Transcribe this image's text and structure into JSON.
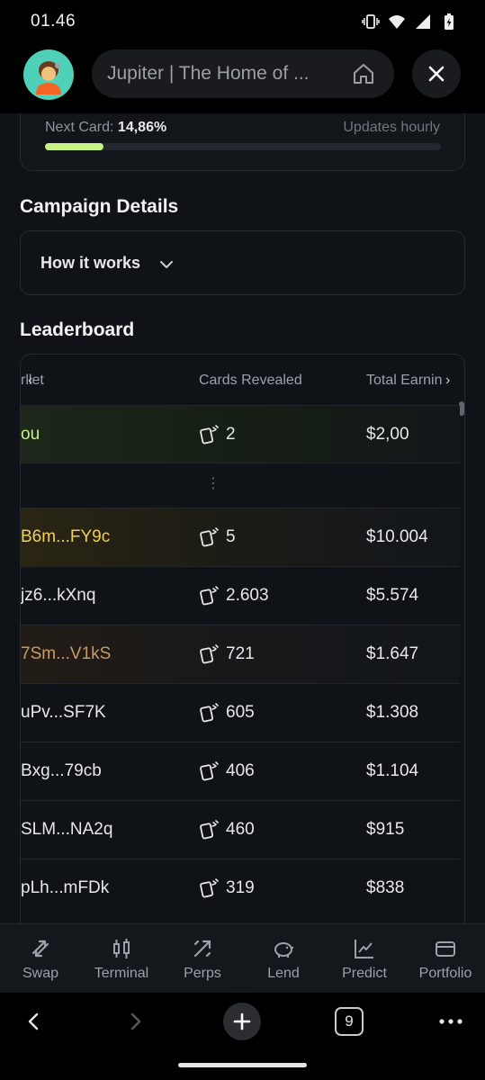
{
  "status_bar": {
    "time": "01.46",
    "icons": [
      "vibrate-icon",
      "wifi-icon",
      "signal-icon",
      "battery-icon"
    ]
  },
  "browser": {
    "url_title": "Jupiter | The Home of ...",
    "avatar_icon": "user-avatar-icon",
    "home_icon": "home-icon",
    "close_icon": "close-icon"
  },
  "progress": {
    "label": "Next Card:",
    "percent_text": "14,86%",
    "update_text": "Updates hourly",
    "fill_fraction": 0.1486,
    "fill_color": "#c7f284"
  },
  "campaign": {
    "title": "Campaign Details",
    "how_label": "How it works"
  },
  "leaderboard": {
    "title": "Leaderboard",
    "columns": {
      "wallet": "rllet",
      "cards": "Cards Revealed",
      "earnings": "Total Earnin"
    },
    "you_row": {
      "wallet": "ou",
      "cards": "2",
      "earnings": "$2,00",
      "color": "#c7f284"
    },
    "gap_dots": "⋮",
    "rows": [
      {
        "wallet": "B6m...FY9c",
        "cards": "5",
        "earnings": "$10.004",
        "color": "#f2cf5b"
      },
      {
        "wallet": "jz6...kXnq",
        "cards": "2.603",
        "earnings": "$5.574",
        "color": "#e6e8eb"
      },
      {
        "wallet": "7Sm...V1kS",
        "cards": "721",
        "earnings": "$1.647",
        "color": "#c99a63"
      },
      {
        "wallet": "uPv...SF7K",
        "cards": "605",
        "earnings": "$1.308",
        "color": "#e6e8eb"
      },
      {
        "wallet": "Bxg...79cb",
        "cards": "406",
        "earnings": "$1.104",
        "color": "#e6e8eb"
      },
      {
        "wallet": "SLM...NA2q",
        "cards": "460",
        "earnings": "$915",
        "color": "#e6e8eb"
      },
      {
        "wallet": "pLh...mFDk",
        "cards": "319",
        "earnings": "$838",
        "color": "#e6e8eb"
      }
    ]
  },
  "app_nav": [
    {
      "label": "Swap",
      "icon": "swap-icon"
    },
    {
      "label": "Terminal",
      "icon": "candlestick-icon"
    },
    {
      "label": "Perps",
      "icon": "perps-icon"
    },
    {
      "label": "Lend",
      "icon": "piggy-bank-icon"
    },
    {
      "label": "Predict",
      "icon": "trend-chart-icon"
    },
    {
      "label": "Portfolio",
      "icon": "wallet-icon"
    }
  ],
  "browser_bar": {
    "tab_count": "9",
    "back_icon": "chevron-left-icon",
    "forward_icon": "chevron-right-icon",
    "new_tab_icon": "plus-icon",
    "menu_icon": "more-icon"
  }
}
